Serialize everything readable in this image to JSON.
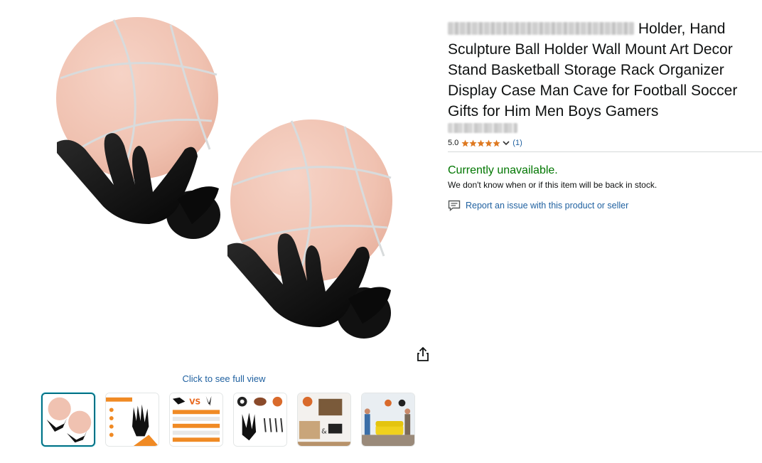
{
  "product": {
    "title_visible": "Holder, Hand Sculpture Ball Holder Wall Mount Art Decor Stand Basketball Storage Rack Organizer Display Case Man Cave for Football Soccer Gifts for Him Men Boys Gamers",
    "rating_value": "5.0",
    "rating_stars": 5,
    "rating_count": "(1)",
    "availability": "Currently unavailable.",
    "availability_note": "We don't know when or if this item will be back in stock.",
    "report_link": "Report an issue with this product or seller"
  },
  "gallery": {
    "full_view_link": "Click to see full view",
    "share_icon": "share-icon",
    "thumbnails": [
      {
        "name": "thumbnail-basketball-holders",
        "selected": true
      },
      {
        "name": "thumbnail-product-advantages",
        "selected": false
      },
      {
        "name": "thumbnail-comparison-chart",
        "selected": false
      },
      {
        "name": "thumbnail-ball-types",
        "selected": false
      },
      {
        "name": "thumbnail-room-display",
        "selected": false
      },
      {
        "name": "thumbnail-living-room-scene",
        "selected": false
      }
    ]
  },
  "colors": {
    "link": "#2162a1",
    "availability": "#007600",
    "star": "#de7921",
    "selected_thumb_border": "#007185"
  }
}
